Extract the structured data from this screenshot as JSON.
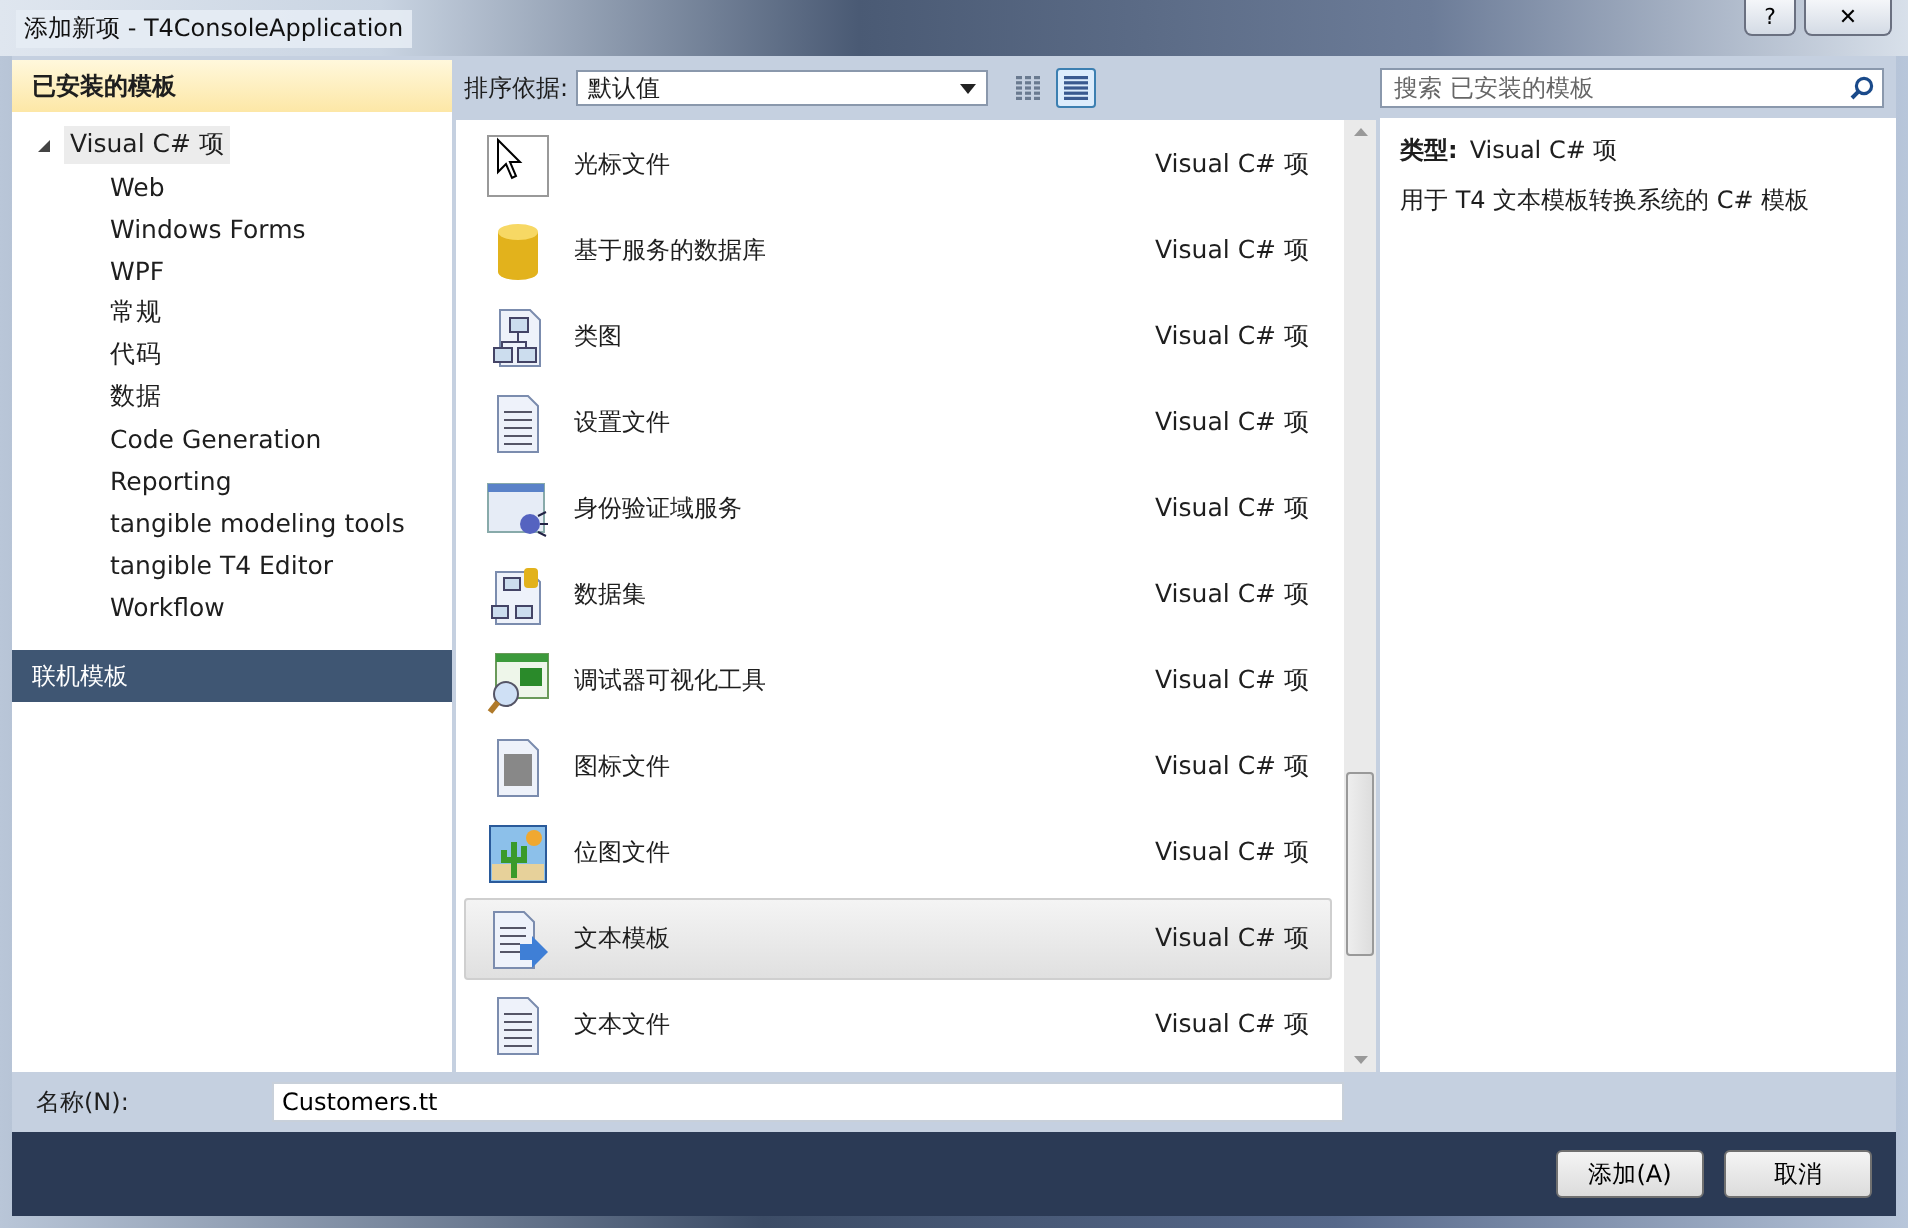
{
  "window": {
    "title": "添加新项 - T4ConsoleApplication",
    "buttons": [
      "?",
      "✕"
    ]
  },
  "sidebar": {
    "sections": [
      {
        "label": "已安装的模板",
        "selected": true,
        "tree": [
          {
            "label": "Visual C# 项",
            "expanded": true,
            "selected": true,
            "children": [
              {
                "label": "Web",
                "selected": false
              },
              {
                "label": "Windows Forms",
                "selected": false
              },
              {
                "label": "WPF",
                "selected": false
              },
              {
                "label": "常规",
                "selected": false
              },
              {
                "label": "代码",
                "selected": false
              },
              {
                "label": "数据",
                "selected": false
              },
              {
                "label": "Code Generation",
                "selected": false
              },
              {
                "label": "Reporting",
                "selected": false
              },
              {
                "label": "tangible modeling tools",
                "selected": false
              },
              {
                "label": "tangible T4 Editor",
                "selected": false
              },
              {
                "label": "Workflow",
                "selected": false
              }
            ]
          }
        ]
      },
      {
        "label": "联机模板",
        "selected": false
      }
    ]
  },
  "toolbar": {
    "sort_label": "排序依据:",
    "sort_value": "默认值",
    "views": [
      {
        "kind": "small",
        "selected": false
      },
      {
        "kind": "list",
        "selected": true
      }
    ]
  },
  "search": {
    "placeholder": "搜索 已安装的模板"
  },
  "items": [
    {
      "kind": "cursor",
      "name": "光标文件",
      "type": "Visual C# 项",
      "selected": false
    },
    {
      "kind": "database",
      "name": "基于服务的数据库",
      "type": "Visual C# 项",
      "selected": false
    },
    {
      "kind": "diagram",
      "name": "类图",
      "type": "Visual C# 项",
      "selected": false
    },
    {
      "kind": "settings",
      "name": "设置文件",
      "type": "Visual C# 项",
      "selected": false
    },
    {
      "kind": "service",
      "name": "身份验证域服务",
      "type": "Visual C# 项",
      "selected": false
    },
    {
      "kind": "dataset",
      "name": "数据集",
      "type": "Visual C# 项",
      "selected": false
    },
    {
      "kind": "visualizer",
      "name": "调试器可视化工具",
      "type": "Visual C# 项",
      "selected": false
    },
    {
      "kind": "iconfile",
      "name": "图标文件",
      "type": "Visual C# 项",
      "selected": false
    },
    {
      "kind": "bitmap",
      "name": "位图文件",
      "type": "Visual C# 项",
      "selected": false
    },
    {
      "kind": "template",
      "name": "文本模板",
      "type": "Visual C# 项",
      "selected": true
    },
    {
      "kind": "textfile",
      "name": "文本文件",
      "type": "Visual C# 项",
      "selected": false
    }
  ],
  "details": {
    "type_label": "类型:",
    "type_value": "Visual C# 项",
    "description": "用于 T4 文本模板转换系统的 C# 模板"
  },
  "name_field": {
    "label": "名称(N):",
    "value": "Customers.tt"
  },
  "buttons": [
    "添加(A)",
    "取消"
  ]
}
